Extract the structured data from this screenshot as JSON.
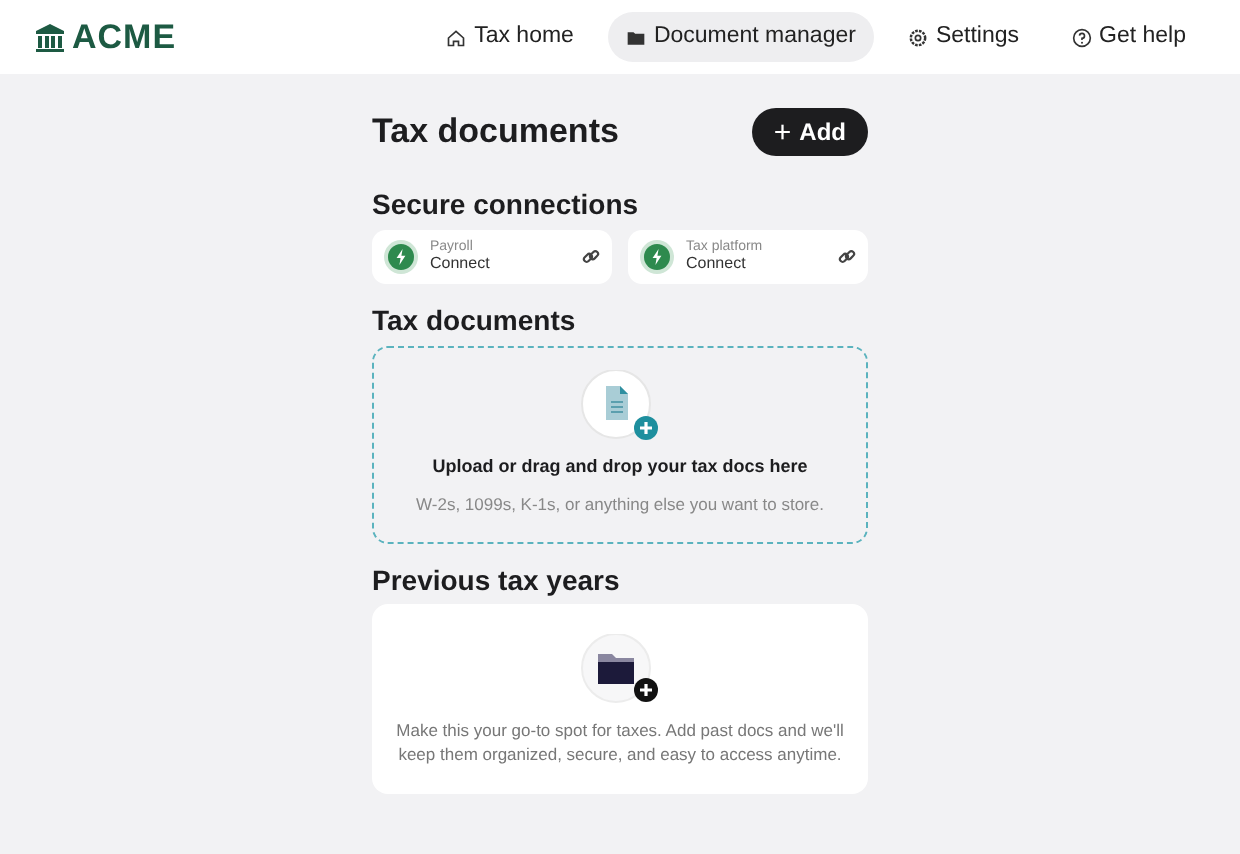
{
  "logo": {
    "text": "ACME"
  },
  "nav": [
    {
      "label": "Tax home",
      "kind": "home",
      "selected": false
    },
    {
      "label": "Document manager",
      "kind": "folder",
      "selected": true
    },
    {
      "label": "Settings",
      "kind": "gear",
      "selected": false
    },
    {
      "label": "Get help",
      "kind": "help",
      "selected": false
    }
  ],
  "page_title": "Tax documents",
  "add_button": {
    "icon": "+",
    "label": "Add"
  },
  "secure_connections": {
    "heading": "Secure connections",
    "items": [
      {
        "name": "Payroll",
        "action": "Connect"
      },
      {
        "name": "Tax platform",
        "action": "Connect"
      }
    ]
  },
  "tax_documents": {
    "heading": "Tax documents",
    "title": "Upload or drag and drop your tax docs here",
    "subtitle": "W-2s, 1099s, K-1s, or anything else you want to store."
  },
  "previous_tax_years": {
    "heading": "Previous tax years",
    "text": "Make this your go-to spot for taxes. Add past docs and we'll keep them organized, secure, and easy to access anytime."
  }
}
